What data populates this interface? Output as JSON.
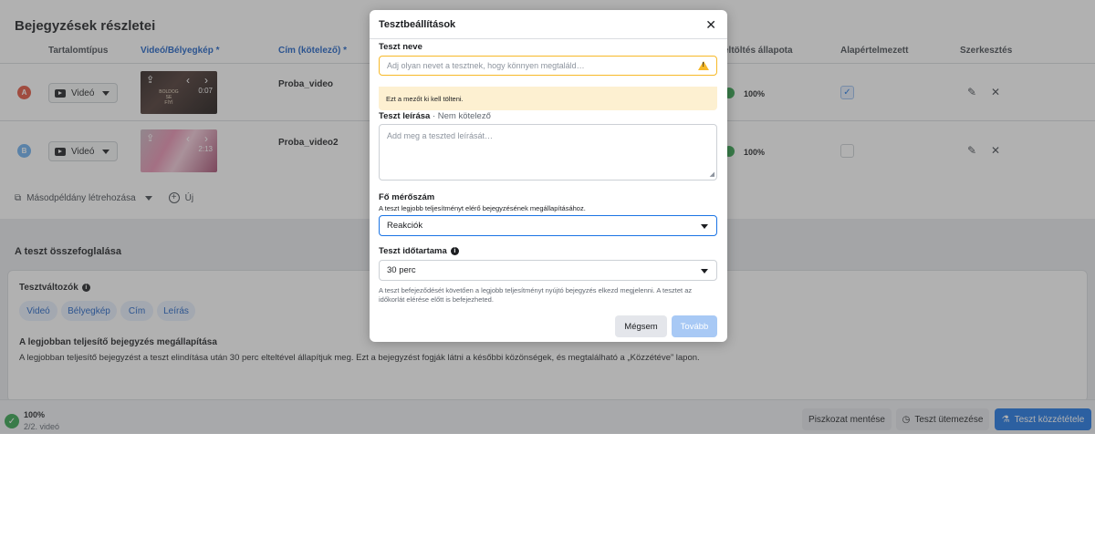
{
  "posts": {
    "title": "Bejegyzések részletei",
    "columns": {
      "type": "Tartalomtípus",
      "video": "Videó/Bélyegkép *",
      "title": "Cím (kötelező) *",
      "upload": "eltöltés állapota",
      "default": "Alapértelmezett",
      "edit": "Szerkesztés"
    },
    "rows": [
      {
        "badge": "A",
        "type": "Videó",
        "duration": "0:07",
        "title": "Proba_video",
        "upload_pct": "100%",
        "default_checked": true
      },
      {
        "badge": "B",
        "type": "Videó",
        "duration": "2:13",
        "title": "Proba_video2",
        "upload_pct": "100%",
        "default_checked": false
      }
    ],
    "thumb_text": "BOLDOG\nSE\nFİYİ",
    "copy_label": "Másodpéldány létrehozása",
    "new_label": "Új"
  },
  "summary": {
    "title": "A teszt összefoglalása",
    "variables_label": "Tesztváltozók",
    "chips": [
      "Videó",
      "Bélyegkép",
      "Cím",
      "Leírás"
    ],
    "best_title": "A legjobban teljesítő bejegyzés megállapítása",
    "best_text": "A legjobban teljesítő bejegyzést a teszt elindítása után 30 perc elteltével állapítjuk meg. Ezt a bejegyzést fogják látni a későbbi közönségek, és megtalálható a „Közzétéve” lapon."
  },
  "footer": {
    "progress": "100%",
    "count": "2/2. videó",
    "save_draft": "Piszkozat mentése",
    "schedule": "Teszt ütemezése",
    "publish": "Teszt közzététele"
  },
  "modal": {
    "title": "Tesztbeállítások",
    "name_label": "Teszt neve",
    "name_placeholder": "Adj olyan nevet a tesztnek, hogy könnyen megtaláld…",
    "name_error": "Ezt a mezőt ki kell tölteni.",
    "desc_label": "Teszt leírása",
    "desc_optional": "· Nem kötelező",
    "desc_placeholder": "Add meg a teszted leírását…",
    "metric_label": "Fő mérőszám",
    "metric_help": "A teszt legjobb teljesítményt elérő bejegyzésének megállapításához.",
    "metric_value": "Reakciók",
    "duration_label": "Teszt időtartama",
    "duration_value": "30 perc",
    "note": "A teszt befejeződését követően a legjobb teljesítményt nyújtó bejegyzés elkezd megjelenni. A tesztet az időkorlát elérése előtt is befejezheted.",
    "cancel": "Mégsem",
    "next": "Tovább"
  },
  "colors": {
    "accent": "#1b74e4",
    "success": "#31a24c",
    "warning": "#f7b928"
  }
}
